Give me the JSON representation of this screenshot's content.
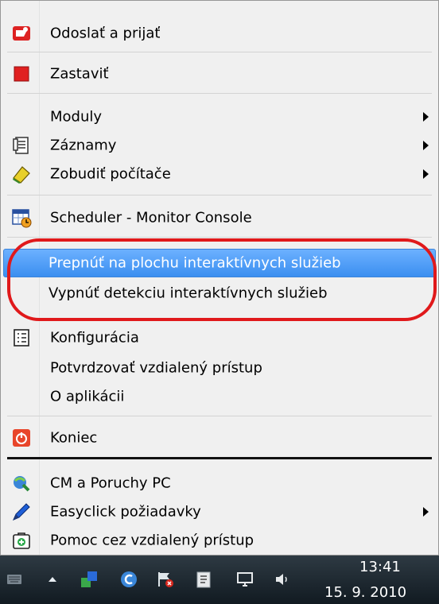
{
  "menu": {
    "send_receive": "Odoslať a prijať",
    "stop": "Zastaviť",
    "modules": "Moduly",
    "records": "Záznamy",
    "wake_computers": "Zobudiť počítače",
    "scheduler": "Scheduler - Monitor Console",
    "switch_desktop": "Prepnúť na plochu interaktívnych služieb",
    "disable_detection": "Vypnúť detekciu interaktívnych služieb",
    "configuration": "Konfigurácia",
    "confirm_remote": "Potvrdzovať vzdialený prístup",
    "about": "O aplikácii",
    "exit": "Koniec",
    "cm_faults": "CM a Poruchy PC",
    "easyclick": "Easyclick požiadavky",
    "remote_help": "Pomoc cez vzdialený prístup"
  },
  "taskbar": {
    "time": "13:41",
    "date": "15. 9. 2010"
  },
  "colors": {
    "highlight": "#3b8ff0",
    "ring": "#e0191b",
    "stop_red": "#e02020"
  }
}
